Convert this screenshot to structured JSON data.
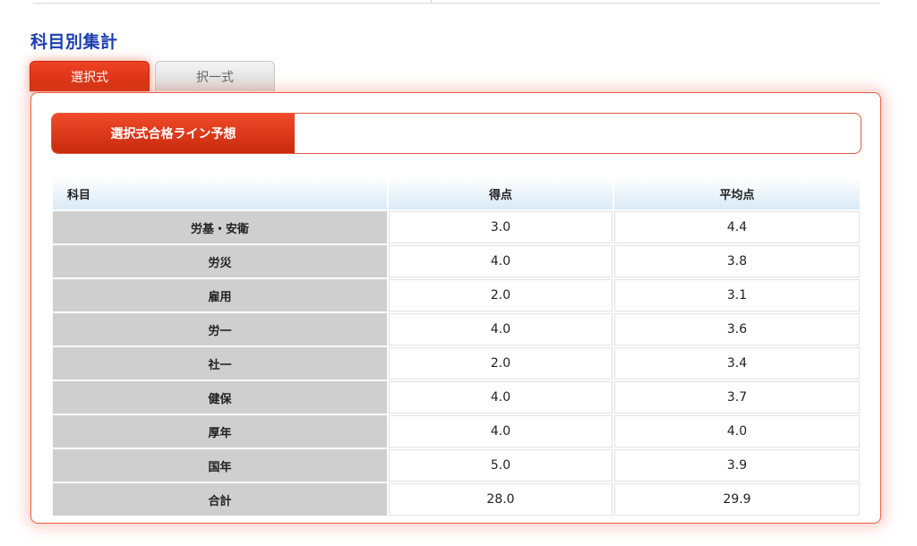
{
  "section_title": "科目別集計",
  "tabs": [
    {
      "label": "選択式",
      "active": true
    },
    {
      "label": "択一式",
      "active": false
    }
  ],
  "heading_label": "選択式合格ライン予想",
  "table": {
    "headers": [
      "科目",
      "得点",
      "平均点"
    ],
    "rows": [
      {
        "subject": "労基・安衛",
        "score": "3.0",
        "average": "4.4"
      },
      {
        "subject": "労災",
        "score": "4.0",
        "average": "3.8"
      },
      {
        "subject": "雇用",
        "score": "2.0",
        "average": "3.1"
      },
      {
        "subject": "労一",
        "score": "4.0",
        "average": "3.6"
      },
      {
        "subject": "社一",
        "score": "2.0",
        "average": "3.4"
      },
      {
        "subject": "健保",
        "score": "4.0",
        "average": "3.7"
      },
      {
        "subject": "厚年",
        "score": "4.0",
        "average": "4.0"
      },
      {
        "subject": "国年",
        "score": "5.0",
        "average": "3.9"
      },
      {
        "subject": "合計",
        "score": "28.0",
        "average": "29.9"
      }
    ]
  },
  "colors": {
    "accent": "#d9330f",
    "title": "#1b3fb0",
    "subject_cell": "#cfcfcf",
    "header_gradient_end": "#d9eaf6"
  }
}
